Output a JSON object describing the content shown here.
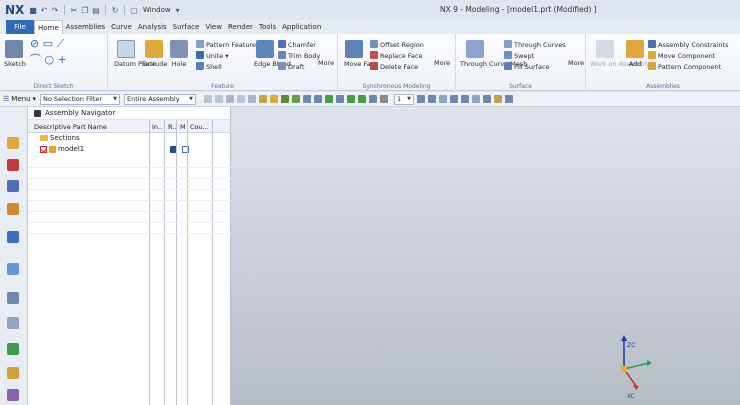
{
  "titlebar": {
    "logo": "NX",
    "window_menu": "Window",
    "app_title": "NX 9 - Modeling - [model1.prt (Modified) ]"
  },
  "menubar": {
    "file": "File",
    "tabs": [
      "Home",
      "Assemblies",
      "Curve",
      "Analysis",
      "Surface",
      "View",
      "Render",
      "Tools",
      "Application"
    ],
    "active": "Home"
  },
  "ribbon": {
    "direct_sketch": {
      "label": "Direct Sketch",
      "sketch": "Sketch"
    },
    "feature": {
      "label": "Feature",
      "datum_plane": "Datum Plane",
      "extrude": "Extrude",
      "hole": "Hole",
      "pattern_feature": "Pattern Feature",
      "unite": "Unite",
      "shell": "Shell",
      "edge_blend": "Edge Blend",
      "chamfer": "Chamfer",
      "trim_body": "Trim Body",
      "draft": "Draft",
      "more": "More"
    },
    "sync": {
      "label": "Synchronous Modeling",
      "move_face": "Move Face",
      "offset_region": "Offset Region",
      "replace_face": "Replace Face",
      "delete_face": "Delete Face",
      "more": "More"
    },
    "surface": {
      "label": "Surface",
      "through_curve_mesh": "Through Curve Mesh",
      "through_curves": "Through Curves",
      "swept": "Swept",
      "fill_surface": "Fill Surface",
      "more": "More"
    },
    "assemblies": {
      "label": "Assemblies",
      "work_on_assembly": "Work on Assembly",
      "add": "Add",
      "assembly_constraints": "Assembly Constraints",
      "move_component": "Move Component",
      "pattern_component": "Pattern Component"
    }
  },
  "selbar": {
    "menu": "Menu",
    "filter": "No Selection Filter",
    "scope": "Entire Assembly",
    "layer": "1"
  },
  "navigator": {
    "title": "Assembly Navigator",
    "columns": [
      "Descriptive Part Name",
      "In..",
      "R..",
      "M",
      "Cou..."
    ],
    "rows": [
      "Sections",
      "model1"
    ]
  },
  "triad": {
    "zc": "ZC",
    "xc": "XC"
  },
  "colors": {
    "file_tab": "#2c6bb6",
    "accent": "#1b4a8a"
  }
}
